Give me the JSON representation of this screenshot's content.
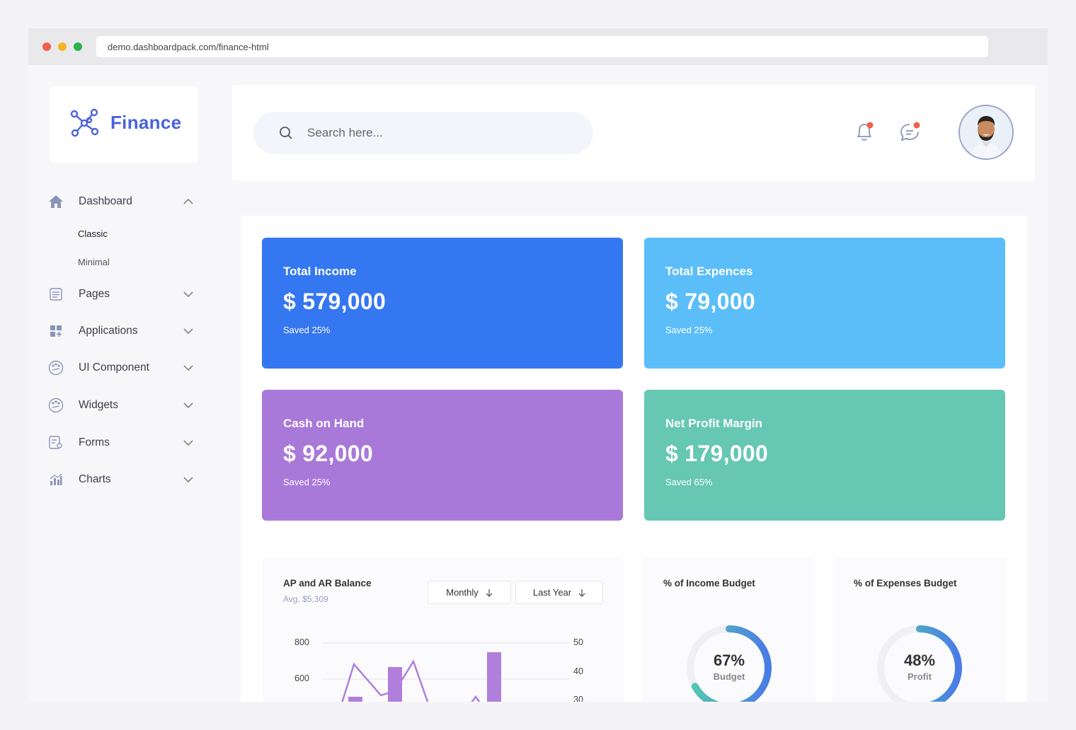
{
  "browser": {
    "url": "demo.dashboardpack.com/finance-html"
  },
  "brand": {
    "name": "Finance",
    "color": "#4a63db"
  },
  "sidebar": {
    "items": [
      {
        "label": "Dashboard",
        "icon": "home-icon",
        "expanded": true
      },
      {
        "label": "Pages",
        "icon": "pages-icon"
      },
      {
        "label": "Applications",
        "icon": "applications-icon"
      },
      {
        "label": "UI Component",
        "icon": "palette-icon"
      },
      {
        "label": "Widgets",
        "icon": "palette-icon"
      },
      {
        "label": "Forms",
        "icon": "forms-icon"
      },
      {
        "label": "Charts",
        "icon": "chart-icon"
      }
    ],
    "dashboard_sub": [
      {
        "label": "Classic",
        "active": true
      },
      {
        "label": "Minimal",
        "active": false
      }
    ]
  },
  "header": {
    "search_placeholder": "Search here...",
    "notification_dot_color": "#f25f4c"
  },
  "stats": [
    {
      "title": "Total Income",
      "value": "$ 579,000",
      "sub": "Saved 25%",
      "color": "#3577f1"
    },
    {
      "title": "Total Expences",
      "value": "$ 79,000",
      "sub": "Saved 25%",
      "color": "#5bbef9"
    },
    {
      "title": "Cash on Hand",
      "value": "$ 92,000",
      "sub": "Saved 25%",
      "color": "#a979d9"
    },
    {
      "title": "Net Profit Margin",
      "value": "$ 179,000",
      "sub": "Saved 65%",
      "color": "#66c7b2"
    }
  ],
  "balance_panel": {
    "title": "AP and AR Balance",
    "avg": "Avg. $5,309",
    "filter_period": "Monthly",
    "filter_range": "Last Year",
    "left_axis_ticks": [
      "800",
      "600"
    ],
    "right_axis_ticks": [
      "50",
      "40",
      "30"
    ]
  },
  "income_budget": {
    "title": "% of Income Budget",
    "percent": "67%",
    "caption": "Budget",
    "value": 67
  },
  "expenses_budget": {
    "title": "% of Expenses Budget",
    "percent": "48%",
    "caption": "Profit",
    "value": 48
  }
}
